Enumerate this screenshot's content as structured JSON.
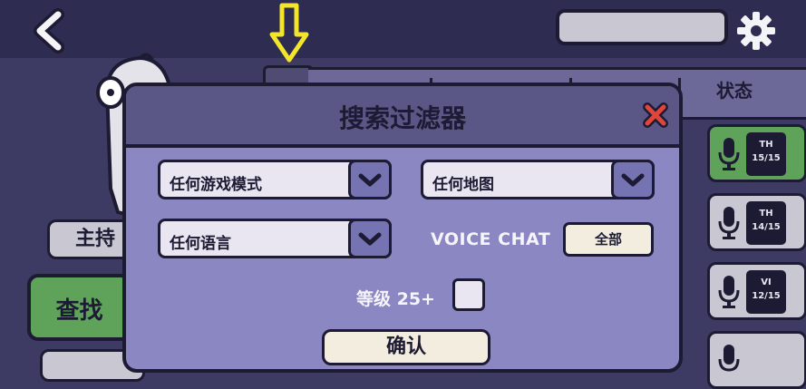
{
  "header": {
    "back_icon": "chevron-left-icon",
    "settings_icon": "gear-icon",
    "search_value": ""
  },
  "columns": {
    "status_label": "状态"
  },
  "left_menu": {
    "host_label": "主持",
    "find_label": "查找"
  },
  "lobbies": [
    {
      "code": "TH",
      "count": "15/15",
      "active": true
    },
    {
      "code": "TH",
      "count": "14/15",
      "active": false
    },
    {
      "code": "VI",
      "count": "12/15",
      "active": false
    },
    {
      "code": "",
      "count": "",
      "active": false
    }
  ],
  "filter_modal": {
    "title": "搜索过滤器",
    "game_mode": "任何游戏模式",
    "map": "任何地图",
    "language": "任何语言",
    "voice_chat_label": "VOICE CHAT",
    "voice_chat_value": "全部",
    "level_label": "等级 25+",
    "level_checked": false,
    "confirm_label": "确认"
  },
  "colors": {
    "accent_green": "#5fa35a",
    "modal_bg": "#8a87c2",
    "close_red": "#e0453a",
    "arrow_yellow": "#f3e52a"
  }
}
